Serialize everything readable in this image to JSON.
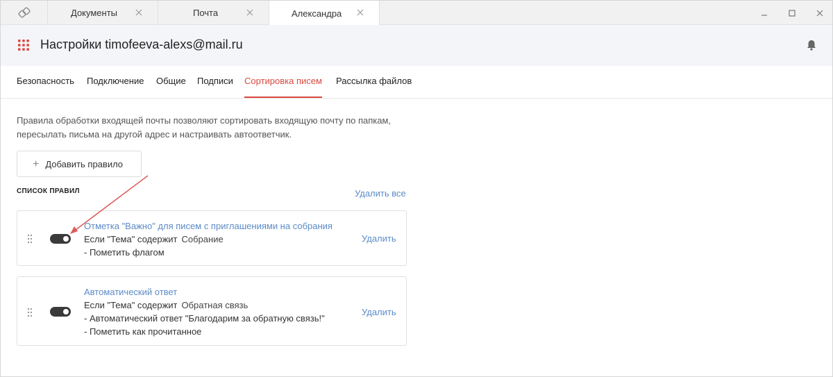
{
  "tabs": [
    {
      "label": "Документы",
      "active": false
    },
    {
      "label": "Почта",
      "active": false
    },
    {
      "label": "Александра",
      "active": true
    }
  ],
  "icons": {
    "app_logo": "app-logo-icon",
    "apps_grid": "grid-icon",
    "notifications": "bell-icon",
    "tab_close": "close-icon",
    "drag": "drag-handle-icon"
  },
  "colors": {
    "accent_active_tab": "#d9493f",
    "link": "#5b8bc6",
    "toggle_on": "#3a3a3a",
    "annotation_arrow": "#e05a5a",
    "grid_icon": "#d9493f"
  },
  "header": {
    "title": "Настройки timofeeva-alexs@mail.ru"
  },
  "settings_tabs": [
    {
      "label": "Безопасность",
      "active": false
    },
    {
      "label": "Подключение",
      "active": false
    },
    {
      "label": "Общие",
      "active": false
    },
    {
      "label": "Подписи",
      "active": false
    },
    {
      "label": "Сортировка писем",
      "active": true
    },
    {
      "label": "Рассылка файлов",
      "active": false
    }
  ],
  "main": {
    "description_line1": "Правила обработки входящей почты позволяют сортировать входящую почту по папкам,",
    "description_line2": "пересылать письма на другой адрес и настраивать автоответчик.",
    "add_rule_label": "Добавить правило",
    "list_heading": "СПИСОК ПРАВИЛ",
    "delete_all_label": "Удалить все"
  },
  "rules": [
    {
      "title": "Отметка \"Важно\" для писем с приглашениями на собрания",
      "condition": "Если \"Тема\" содержит",
      "condition_value": "Собрание",
      "actions": [
        "- Пометить флагом"
      ],
      "enabled": true,
      "delete_label": "Удалить"
    },
    {
      "title": "Автоматический ответ",
      "condition": "Если \"Тема\" содержит",
      "condition_value": "Обратная связь",
      "actions": [
        "- Автоматический ответ \"Благодарим за обратную связь!\"",
        "- Пометить как прочитанное"
      ],
      "enabled": true,
      "delete_label": "Удалить"
    }
  ]
}
